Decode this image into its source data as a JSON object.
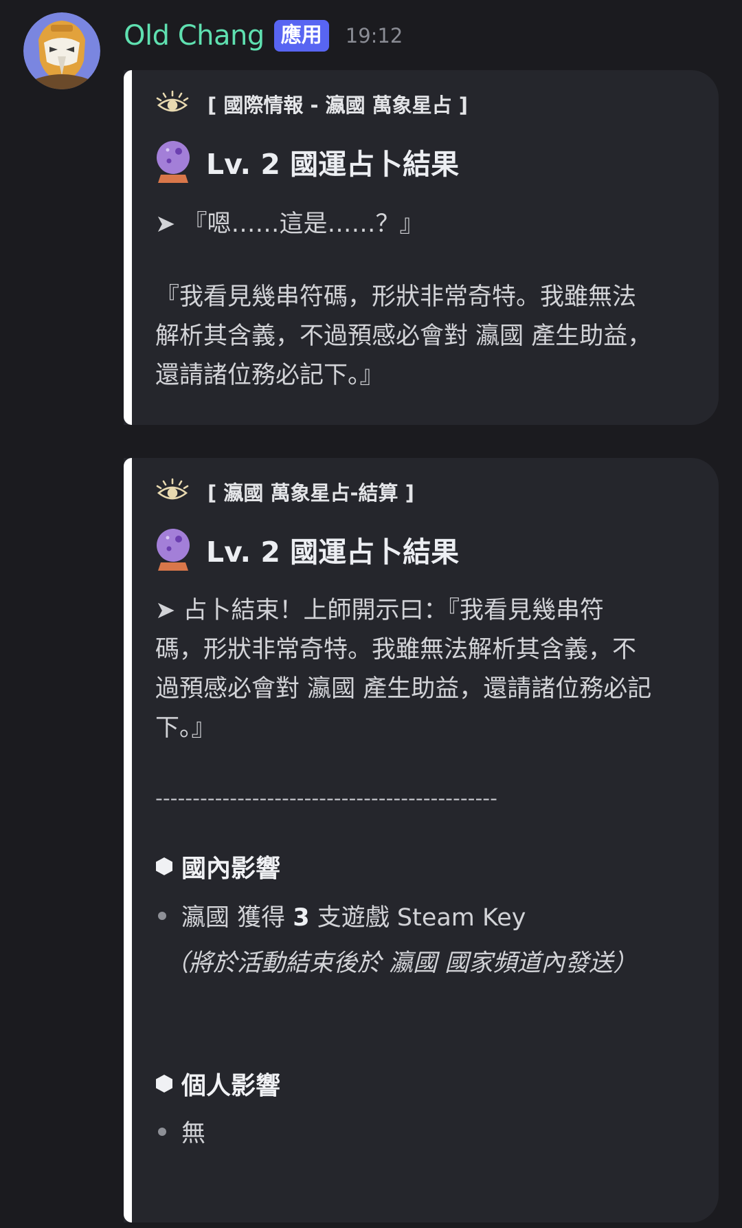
{
  "message": {
    "username": "Old Chang",
    "app_badge": "應用",
    "timestamp": "19:12",
    "avatar_icon": "robot-mask-avatar"
  },
  "embeds": [
    {
      "author": "[ 國際情報 - 瀛國 萬象星占 ]",
      "author_icon": "eye-icon",
      "title_icon": "crystal-ball-icon",
      "title": "Lv. 2 國運占卜結果",
      "line1": "『嗯……這是……？』",
      "quote": "『我看見幾串符碼，形狀非常奇特。我雖無法\n解析其含義，不過預感必會對 瀛國 產生助益，\n還請諸位務必記下。』"
    },
    {
      "author": "[ 瀛國 萬象星占-結算 ]",
      "author_icon": "eye-icon",
      "title_icon": "crystal-ball-icon",
      "title": "Lv. 2 國運占卜結果",
      "result": "占卜結束！上師開示曰：『我看見幾串符\n碼，形狀非常奇特。我雖無法解析其含義，不\n過預感必會對 瀛國 產生助益，還請諸位務必記\n下。』",
      "divider": "----------------------------------------------",
      "domestic_heading": "國內影響",
      "domestic_item_pre": "瀛國 獲得 ",
      "domestic_item_num": "3",
      "domestic_item_post": " 支遊戲 Steam Key",
      "domestic_note": "（將於活動結束後於 瀛國 國家頻道內發送）",
      "personal_heading": "個人影響",
      "personal_item": "無"
    }
  ],
  "colors": {
    "background": "#1b1b1f",
    "embed_bg": "#25262c",
    "embed_border": "#ffffff",
    "username": "#5fe0b0",
    "badge": "#5865f2"
  }
}
